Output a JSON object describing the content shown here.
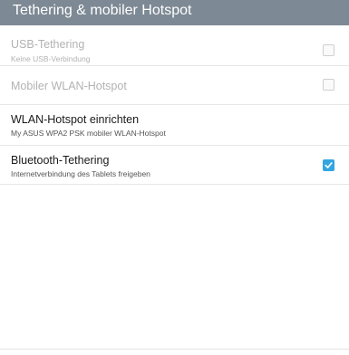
{
  "header": {
    "title": "Tethering & mobiler Hotspot"
  },
  "settings": {
    "items": [
      {
        "title": "USB-Tethering",
        "summary": "Keine USB-Verbindung",
        "enabled": false,
        "checked": false
      },
      {
        "title": "Mobiler WLAN-Hotspot",
        "enabled": false,
        "checked": false
      },
      {
        "title": "WLAN-Hotspot einrichten",
        "summary": "My ASUS WPA2 PSK mobiler WLAN-Hotspot",
        "enabled": true
      },
      {
        "title": "Bluetooth-Tethering",
        "summary": "Internetverbindung des Tablets freigeben",
        "enabled": true,
        "checked": true
      }
    ]
  },
  "colors": {
    "header_background": "#7d8994",
    "checkbox_checked": "#33a6e0",
    "disabled_text": "#b2b2b2"
  },
  "icons": {
    "checked": "checkmark-icon"
  }
}
